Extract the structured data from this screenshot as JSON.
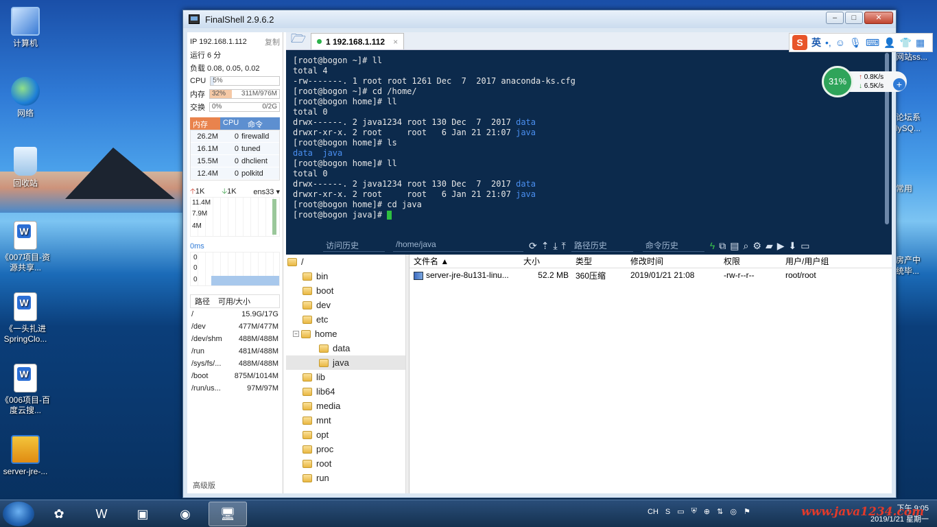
{
  "desktop": {
    "icons": [
      {
        "label": "计算机"
      },
      {
        "label": "网络"
      },
      {
        "label": "回收站"
      },
      {
        "label": "《007项目-资源共享..."
      },
      {
        "label": "《一头扎进SpringClo..."
      },
      {
        "label": "《006项目-百度云搜..."
      },
      {
        "label": "server-jre-..."
      }
    ],
    "edge_labels": [
      "网站ss...",
      "论坛系",
      "lySQ...",
      "常用",
      "房产中",
      "统毕..."
    ]
  },
  "window": {
    "title": "FinalShell 2.9.6.2",
    "minimize": "–",
    "maximize": "□",
    "close": "✕"
  },
  "sidebar": {
    "ip": "IP 192.168.1.112",
    "copy": "复制",
    "uptime": "运行 6 分",
    "load": "负载 0.08, 0.05, 0.02",
    "cpu_label": "CPU",
    "cpu_value": "5%",
    "cpu_fraction": 0.05,
    "mem_label": "内存",
    "mem_percent": "32%",
    "mem_value": "311M/976M",
    "mem_fraction": 0.32,
    "swap_label": "交换",
    "swap_percent": "0%",
    "swap_value": "0/2G",
    "proc_headers": [
      "内存",
      "CPU",
      "命令"
    ],
    "processes": [
      {
        "mem": "26.2M",
        "cpu": "0",
        "cmd": "firewalld"
      },
      {
        "mem": "16.1M",
        "cpu": "0",
        "cmd": "tuned"
      },
      {
        "mem": "15.5M",
        "cpu": "0",
        "cmd": "dhclient"
      },
      {
        "mem": "12.4M",
        "cpu": "0",
        "cmd": "polkitd"
      }
    ],
    "net_up": "1K",
    "net_down": "1K",
    "net_iface": "ens33",
    "net_scale": [
      "11.4M",
      "7.9M",
      "4M"
    ],
    "ping": "0ms",
    "ping_scale": [
      "0",
      "0",
      "0"
    ],
    "disk_headers": [
      "路径",
      "可用/大小"
    ],
    "disks": [
      {
        "path": "/",
        "size": "15.9G/17G"
      },
      {
        "path": "/dev",
        "size": "477M/477M"
      },
      {
        "path": "/dev/shm",
        "size": "488M/488M"
      },
      {
        "path": "/run",
        "size": "481M/488M"
      },
      {
        "path": "/sys/fs/...",
        "size": "488M/488M"
      },
      {
        "path": "/boot",
        "size": "875M/1014M"
      },
      {
        "path": "/run/us...",
        "size": "97M/97M"
      }
    ],
    "advanced": "高级版"
  },
  "tab": {
    "label": "1 192.168.1.112",
    "close": "×"
  },
  "terminal": {
    "lines": [
      "[root@bogon ~]# ll",
      "total 4",
      "-rw-------. 1 root root 1261 Dec  7  2017 anaconda-ks.cfg",
      "[root@bogon ~]# cd /home/",
      "[root@bogon home]# ll",
      "total 0"
    ],
    "l7_pre": "drwx------. 2 java1234 root 130 Dec  7  2017 ",
    "l7_dir": "data",
    "l8_pre": "drwxr-xr-x. 2 root     root   6 Jan 21 21:07 ",
    "l8_dir": "java",
    "l9": "[root@bogon home]# ls",
    "l10_dir": "data  java",
    "l11": "[root@bogon home]# ll",
    "l12": "total 0",
    "l13_pre": "drwx------. 2 java1234 root 130 Dec  7  2017 ",
    "l13_dir": "data",
    "l14_pre": "drwxr-xr-x. 2 root     root   6 Jan 21 21:07 ",
    "l14_dir": "java",
    "l15": "[root@bogon home]# cd java",
    "l16": "[root@bogon java]# "
  },
  "termbar": {
    "history": "访问历史",
    "path": "/home/java",
    "path_history": "路径历史",
    "cmd_history": "命令历史"
  },
  "tree": {
    "root": "/",
    "items": [
      "bin",
      "boot",
      "dev",
      "etc",
      "home",
      "data",
      "java",
      "lib",
      "lib64",
      "media",
      "mnt",
      "opt",
      "proc",
      "root",
      "run"
    ]
  },
  "files": {
    "headers": [
      "文件名",
      "大小",
      "类型",
      "修改时间",
      "权限",
      "用户/用户组"
    ],
    "rows": [
      {
        "name": "server-jre-8u131-linu...",
        "size": "52.2 MB",
        "type": "360压缩",
        "mtime": "2019/01/21 21:08",
        "perm": "-rw-r--r--",
        "owner": "root/root"
      }
    ]
  },
  "ime": {
    "logo": "S",
    "lang": "英"
  },
  "netwidget": {
    "percent": "31%",
    "up": "0.8K/s",
    "down": "6.5K/s"
  },
  "taskbar": {
    "tray_lang": "CH",
    "time": "下午 9:05",
    "date": "2019/1/21 星期一",
    "watermark": "www.java1234.com"
  }
}
